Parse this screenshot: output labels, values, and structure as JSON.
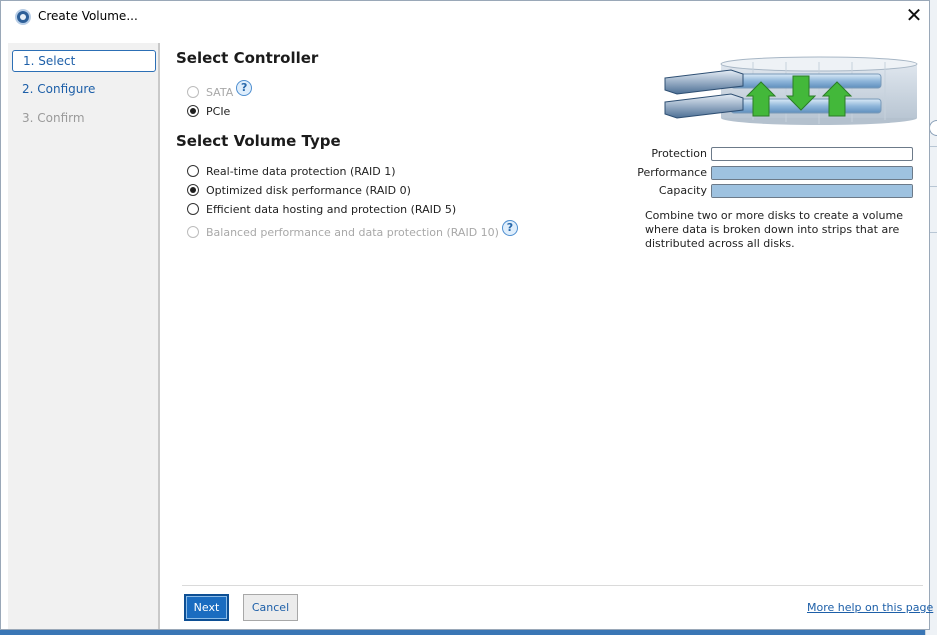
{
  "window": {
    "title": "Create Volume...",
    "close_glyph": "✕"
  },
  "steps": [
    {
      "label": "1. Select",
      "state": "active"
    },
    {
      "label": "2. Configure",
      "state": "enabled"
    },
    {
      "label": "3. Confirm",
      "state": "disabled"
    }
  ],
  "controller": {
    "heading": "Select Controller",
    "options": [
      {
        "label": "SATA",
        "checked": false,
        "disabled": true,
        "help": true
      },
      {
        "label": "PCIe",
        "checked": true,
        "disabled": false,
        "help": false
      }
    ]
  },
  "volume_type": {
    "heading": "Select Volume Type",
    "options": [
      {
        "label": "Real-time data protection (RAID 1)",
        "checked": false,
        "disabled": false
      },
      {
        "label": "Optimized disk performance (RAID 0)",
        "checked": true,
        "disabled": false
      },
      {
        "label": "Efficient data hosting and protection (RAID 5)",
        "checked": false,
        "disabled": false
      },
      {
        "label": "Balanced performance and data protection (RAID 10)",
        "checked": false,
        "disabled": true,
        "help": true
      }
    ]
  },
  "help_glyph": "?",
  "meters": {
    "protection": {
      "label": "Protection",
      "level": 0.0
    },
    "performance": {
      "label": "Performance",
      "level": 1.0
    },
    "capacity": {
      "label": "Capacity",
      "level": 1.0
    }
  },
  "description": "Combine two or more disks to create a volume where data is broken down into strips that are distributed across all disks.",
  "footer": {
    "next_label": "Next",
    "cancel_label": "Cancel",
    "help_link": "More help on this page"
  },
  "colors": {
    "accent": "#1a6cc0",
    "meter_fill": "#9ec2e0",
    "arrow_green": "#43b83a"
  },
  "icons": {
    "app": "raid-app-icon",
    "help": "help-bubble-icon",
    "illustration": "raid0-disks-illustration"
  }
}
